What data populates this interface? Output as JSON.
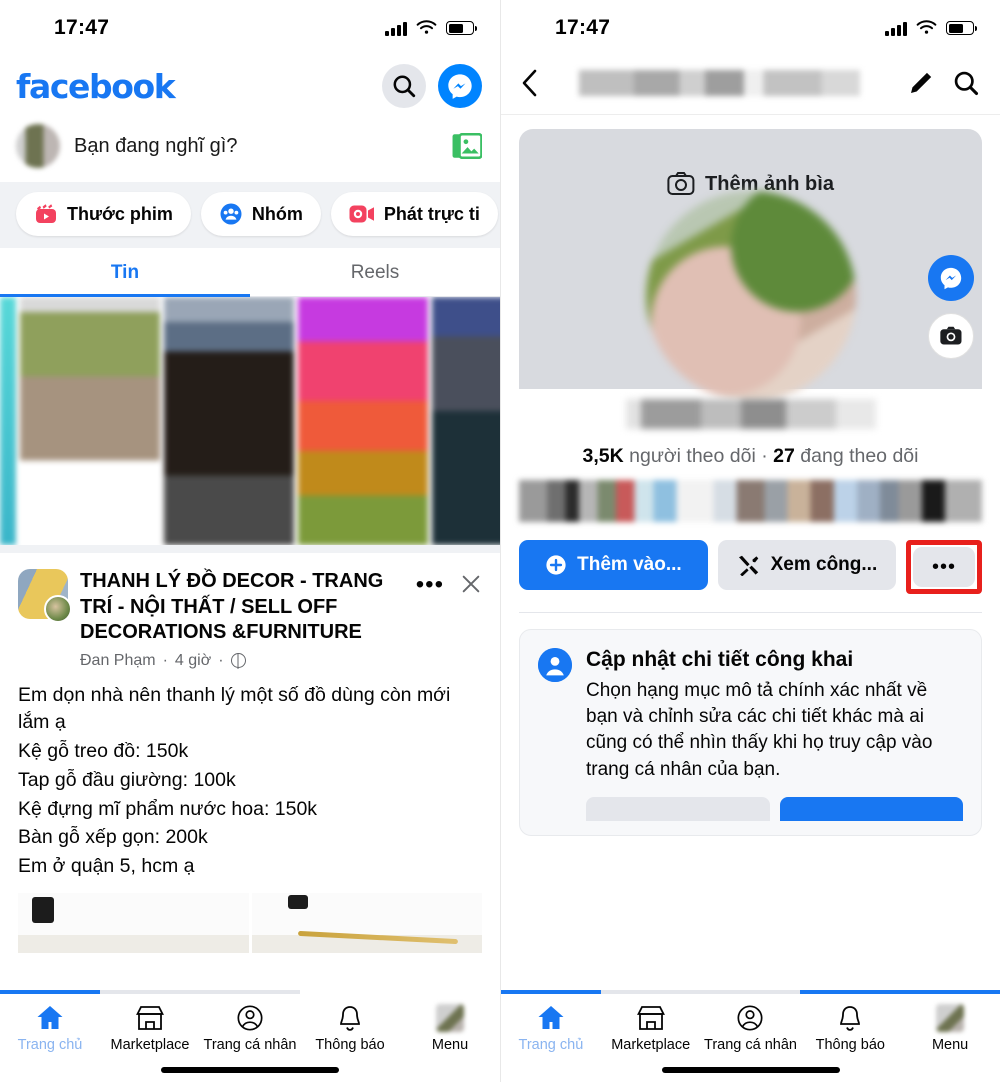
{
  "status_bar": {
    "time": "17:47",
    "signal_icon": "signal-bars-icon",
    "wifi_icon": "wifi-icon",
    "battery_icon": "battery-icon"
  },
  "left": {
    "header": {
      "logo_text": "facebook",
      "search_icon": "search-icon",
      "messenger_icon": "messenger-icon"
    },
    "composer": {
      "placeholder": "Bạn đang nghĩ gì?",
      "photo_icon": "photo-library-icon",
      "avatar": "user-avatar"
    },
    "chips": [
      {
        "label": "Thước phim",
        "icon": "reels-clapper-icon"
      },
      {
        "label": "Nhóm",
        "icon": "groups-icon"
      },
      {
        "label": "Phát trực ti",
        "icon": "live-video-icon"
      }
    ],
    "tabs": [
      {
        "label": "Tin",
        "active": true
      },
      {
        "label": "Reels",
        "active": false
      }
    ],
    "post": {
      "group_name": "THANH LÝ ĐỒ DECOR - TRANG TRÍ - NỘI THẤT / SELL OFF DECORATIONS &FURNITURE",
      "author": "Đan Phạm",
      "time": "4 giờ",
      "privacy_icon": "globe-icon",
      "more_icon": "more-options-icon",
      "close_icon": "close-icon",
      "body_lines": [
        "Em dọn nhà nên thanh lý một số đồ dùng còn mới lắm ạ",
        "Kệ gỗ treo đồ: 150k",
        "Tap gỗ đầu giường: 100k",
        "Kệ đựng mĩ phẩm nước hoa: 150k",
        "Bàn gỗ xếp gọn: 200k",
        "Em ở quận 5, hcm ạ"
      ]
    }
  },
  "right": {
    "header": {
      "back_icon": "back-chevron-icon",
      "name_redacted": "",
      "edit_icon": "edit-pencil-icon",
      "search_icon": "search-icon"
    },
    "cover": {
      "label": "Thêm ảnh bìa",
      "icon": "camera-icon"
    },
    "float_buttons": [
      {
        "icon": "messenger-chat-icon",
        "style": "blue"
      },
      {
        "icon": "camera-icon",
        "style": "white"
      }
    ],
    "stats": {
      "followers_count": "3,5K",
      "followers_label": "người theo dõi",
      "separator": "·",
      "following_count": "27",
      "following_label": "đang theo dõi"
    },
    "actions": {
      "primary_label": "Thêm vào...",
      "primary_icon": "plus-circle-icon",
      "secondary_label": "Xem công...",
      "secondary_icon": "tools-icon",
      "more_icon": "more-options-icon",
      "more_highlighted": true
    },
    "info_card": {
      "icon": "profile-person-icon",
      "title": "Cập nhật chi tiết công khai",
      "text": "Chọn hạng mục mô tả chính xác nhất về bạn và chỉnh sửa các chi tiết khác mà ai cũng có thể nhìn thấy khi họ truy cập vào trang cá nhân của bạn."
    }
  },
  "bottom_nav": [
    {
      "label": "Trang chủ",
      "icon": "home-icon",
      "active": true
    },
    {
      "label": "Marketplace",
      "icon": "marketplace-icon",
      "active": false
    },
    {
      "label": "Trang cá nhân",
      "icon": "profile-icon",
      "active": false
    },
    {
      "label": "Thông báo",
      "icon": "bell-icon",
      "active": false
    },
    {
      "label": "Menu",
      "icon": "menu-avatar-icon",
      "active": false
    }
  ],
  "colors": {
    "fb_blue": "#1877F2",
    "messenger_blue": "#0084FF",
    "chip_bg": "#FFFFFF",
    "page_bg": "#F0F2F5",
    "highlight_red": "#E8201C",
    "secondary_gray": "#E4E6EB"
  }
}
